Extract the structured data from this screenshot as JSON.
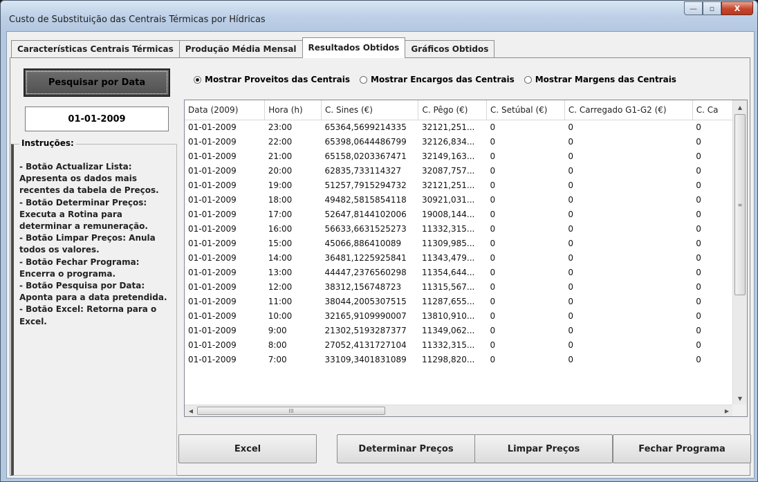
{
  "window": {
    "title": "Custo de Substituição das Centrais Térmicas por Hídricas",
    "controls": {
      "minimize": "—",
      "maximize": "▫",
      "close": "X"
    }
  },
  "tabs": [
    {
      "label": "Características Centrais Térmicas",
      "active": false
    },
    {
      "label": "Produção Média Mensal",
      "active": false
    },
    {
      "label": "Resultados Obtidos",
      "active": true
    },
    {
      "label": "Gráficos Obtidos",
      "active": false
    }
  ],
  "search_button": {
    "label": "Pesquisar por Data"
  },
  "date_field": {
    "value": "01-01-2009"
  },
  "instructions": {
    "title": "Instruções:",
    "lines": [
      "- Botão Actualizar Lista: Apresenta os dados mais recentes da tabela de Preços.",
      "- Botão Determinar Preços: Executa a Rotina para determinar a remuneração.",
      "- Botão Limpar Preços: Anula todos os valores.",
      "- Botão Fechar Programa: Encerra o programa.",
      "- Botão Pesquisa por Data: Aponta para a data pretendida.",
      "- Botão Excel: Retorna para o Excel."
    ]
  },
  "radio_options": [
    {
      "label": "Mostrar Proveitos das Centrais",
      "selected": true
    },
    {
      "label": "Mostrar Encargos das Centrais",
      "selected": false
    },
    {
      "label": "Mostrar Margens das Centrais",
      "selected": false
    }
  ],
  "table": {
    "columns": [
      "Data (2009)",
      "Hora (h)",
      "C. Sines (€)",
      "C. Pêgo (€)",
      "C. Setúbal (€)",
      "C. Carregado G1-G2 (€)",
      "C. Ca"
    ],
    "rows": [
      [
        "01-01-2009",
        "23:00",
        "65364,5699214335",
        "32121,251...",
        "0",
        "0",
        "0"
      ],
      [
        "01-01-2009",
        "22:00",
        "65398,0644486799",
        "32126,834...",
        "0",
        "0",
        "0"
      ],
      [
        "01-01-2009",
        "21:00",
        "65158,0203367471",
        "32149,163...",
        "0",
        "0",
        "0"
      ],
      [
        "01-01-2009",
        "20:00",
        "62835,733114327",
        "32087,757...",
        "0",
        "0",
        "0"
      ],
      [
        "01-01-2009",
        "19:00",
        "51257,7915294732",
        "32121,251...",
        "0",
        "0",
        "0"
      ],
      [
        "01-01-2009",
        "18:00",
        "49482,5815854118",
        "30921,031...",
        "0",
        "0",
        "0"
      ],
      [
        "01-01-2009",
        "17:00",
        "52647,8144102006",
        "19008,144...",
        "0",
        "0",
        "0"
      ],
      [
        "01-01-2009",
        "16:00",
        "56633,6631525273",
        "11332,315...",
        "0",
        "0",
        "0"
      ],
      [
        "01-01-2009",
        "15:00",
        "45066,886410089",
        "11309,985...",
        "0",
        "0",
        "0"
      ],
      [
        "01-01-2009",
        "14:00",
        "36481,1225925841",
        "11343,479...",
        "0",
        "0",
        "0"
      ],
      [
        "01-01-2009",
        "13:00",
        "44447,2376560298",
        "11354,644...",
        "0",
        "0",
        "0"
      ],
      [
        "01-01-2009",
        "12:00",
        "38312,156748723",
        "11315,567...",
        "0",
        "0",
        "0"
      ],
      [
        "01-01-2009",
        "11:00",
        "38044,2005307515",
        "11287,655...",
        "0",
        "0",
        "0"
      ],
      [
        "01-01-2009",
        "10:00",
        "32165,9109990007",
        "13810,910...",
        "0",
        "0",
        "0"
      ],
      [
        "01-01-2009",
        "9:00",
        "21302,5193287377",
        "11349,062...",
        "0",
        "0",
        "0"
      ],
      [
        "01-01-2009",
        "8:00",
        "27052,4131727104",
        "11332,315...",
        "0",
        "0",
        "0"
      ],
      [
        "01-01-2009",
        "7:00",
        "33109,3401831089",
        "11298,820...",
        "0",
        "0",
        "0"
      ]
    ]
  },
  "scrollbars": {
    "up": "▲",
    "down": "▼",
    "left": "◀",
    "right": "▶",
    "v_grip": "≡",
    "h_grip": "III"
  },
  "buttons": {
    "excel": "Excel",
    "determine": "Determinar Preços",
    "clear": "Limpar Preços",
    "close": "Fechar Programa"
  }
}
